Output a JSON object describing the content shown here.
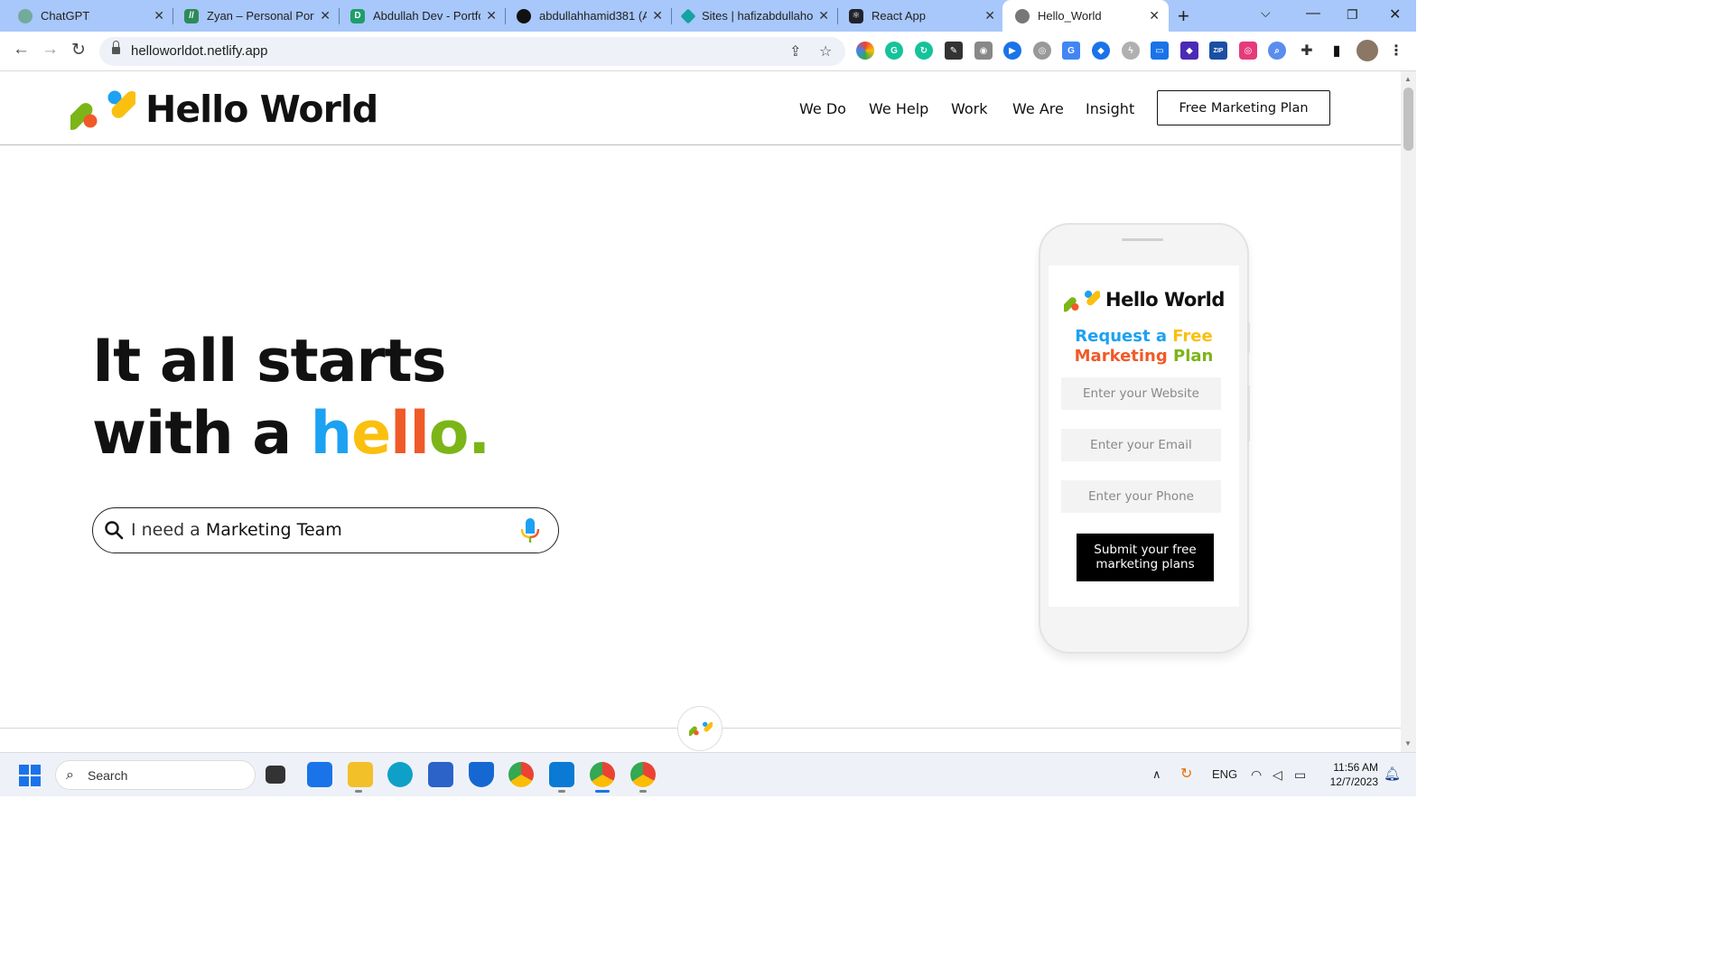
{
  "browser": {
    "tabs": [
      {
        "label": "ChatGPT",
        "icon": "chatgpt-icon",
        "color": "#74aa9c"
      },
      {
        "label": "Zyan – Personal Portf",
        "icon": "zyan-icon",
        "color": "#2d8a5a"
      },
      {
        "label": "Abdullah Dev - Portfo",
        "icon": "abdullah-dev-icon",
        "color": "#1e9e6b"
      },
      {
        "label": "abdullahhamid381 (A",
        "icon": "github-icon",
        "color": "#111111"
      },
      {
        "label": "Sites | hafizabdullaho",
        "icon": "netlify-icon",
        "color": "#14a3a0"
      },
      {
        "label": "React App",
        "icon": "react-icon",
        "color": "#20232a"
      },
      {
        "label": "Hello_World",
        "icon": "globe-icon",
        "color": "#777777"
      }
    ],
    "url": "helloworldot.netlify.app"
  },
  "site": {
    "brand": "Hello World",
    "nav": [
      "We Do",
      "We Help",
      "Work",
      "We Are",
      "Insight"
    ],
    "cta": "Free Marketing Plan",
    "headline_line1": "It all starts",
    "headline_line2_prefix": "with a ",
    "hello_letters": [
      "h",
      "e",
      "l",
      "l",
      "o",
      "."
    ],
    "search_prefix": "I need a ",
    "search_value": "Marketing Team"
  },
  "form": {
    "brand": "Hello World",
    "title_part1": "Request a ",
    "title_part2": "Free",
    "title_part3": "Marketing ",
    "title_part4": "Plan",
    "website_placeholder": "Enter your Website",
    "email_placeholder": "Enter your Email",
    "phone_placeholder": "Enter your Phone",
    "submit_line1": "Submit your free",
    "submit_line2": "marketing plans"
  },
  "colors": {
    "blue": "#1da1f2",
    "yellow": "#fbbf0f",
    "orange": "#f05a28",
    "green": "#7cb518"
  },
  "taskbar": {
    "search_label": "Search",
    "language": "ENG",
    "time": "11:56 AM",
    "date": "12/7/2023"
  }
}
